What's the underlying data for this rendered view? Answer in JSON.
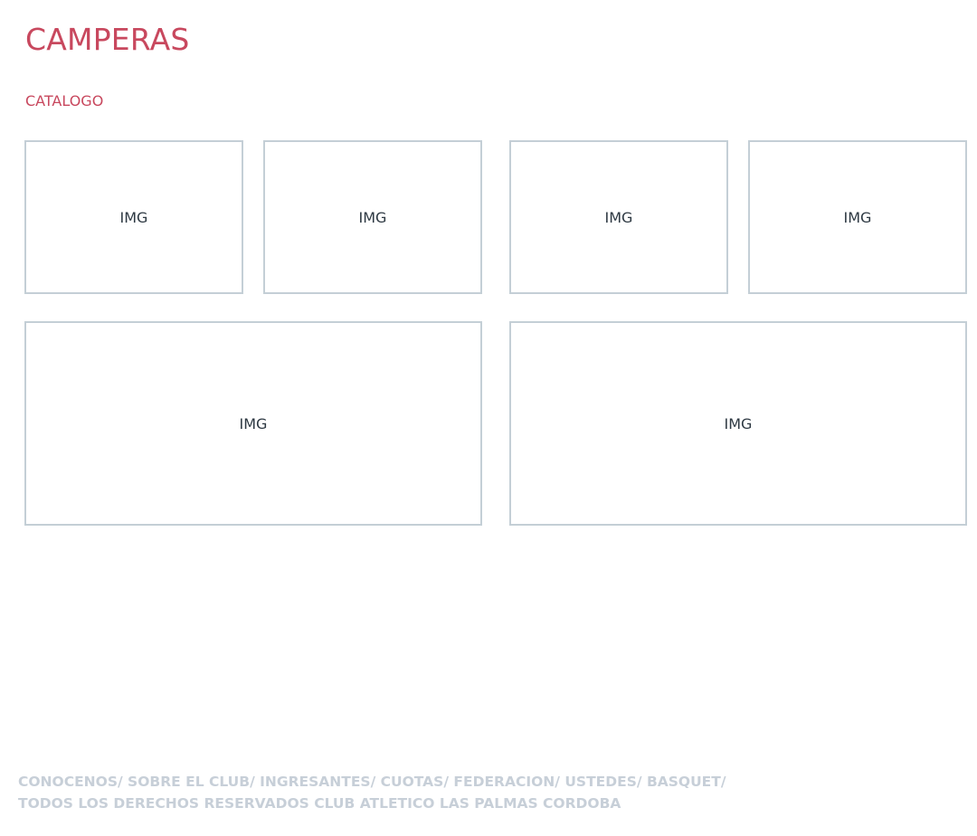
{
  "header": {
    "title": "CAMPERAS",
    "catalog_link": "CATALOGO"
  },
  "gallery": {
    "tiles": [
      {
        "label": "IMG"
      },
      {
        "label": "IMG"
      },
      {
        "label": "IMG"
      },
      {
        "label": "IMG"
      },
      {
        "label": "IMG"
      },
      {
        "label": "IMG"
      }
    ]
  },
  "footer": {
    "links": [
      "CONOCENOS/",
      "SOBRE EL CLUB/",
      "INGRESANTES/",
      "CUOTAS/",
      "FEDERACION/",
      "USTEDES/",
      "BASQUET/"
    ],
    "copyright": "TODOS LOS DERECHOS RESERVADOS CLUB ATLETICO LAS PALMAS CORDOBA"
  },
  "colors": {
    "accent": "#c8485e",
    "tile_border": "#c4cfd6",
    "footer_text": "#c7cfd8",
    "img_text": "#2d3842"
  }
}
